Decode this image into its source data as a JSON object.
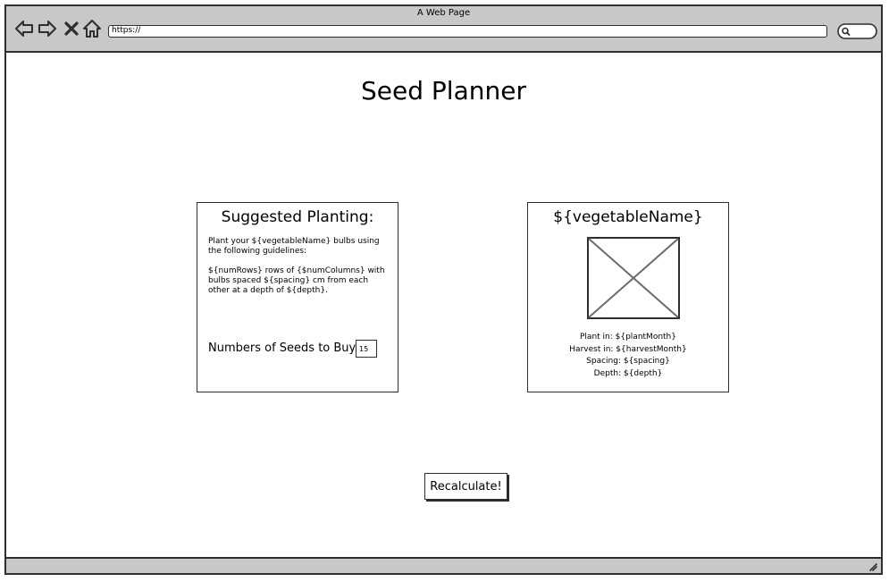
{
  "window": {
    "title": "A Web Page",
    "url": "https://"
  },
  "page": {
    "title": "Seed Planner"
  },
  "planting_card": {
    "heading": "Suggested Planting:",
    "paragraph1": "Plant your ${vegetableName} bulbs using the following guidelines:",
    "paragraph2": "${numRows} rows of {$numColumns} with bulbs spaced ${spacing} cm from each other at a depth of ${depth}.",
    "seeds_label": "Numbers of Seeds to Buy:",
    "seeds_value": "15"
  },
  "vegetable_card": {
    "heading": "${vegetableName}",
    "plant_in": "Plant in: ${plantMonth}",
    "harvest_in": "Harvest in: ${harvestMonth}",
    "spacing": "Spacing: ${spacing}",
    "depth": "Depth: ${depth}"
  },
  "actions": {
    "recalculate_label": "Recalculate!"
  },
  "icons": {
    "back": "arrow-left-icon",
    "forward": "arrow-right-icon",
    "stop": "close-icon",
    "home": "home-icon",
    "search": "search-icon",
    "resize": "resize-grip-icon"
  }
}
